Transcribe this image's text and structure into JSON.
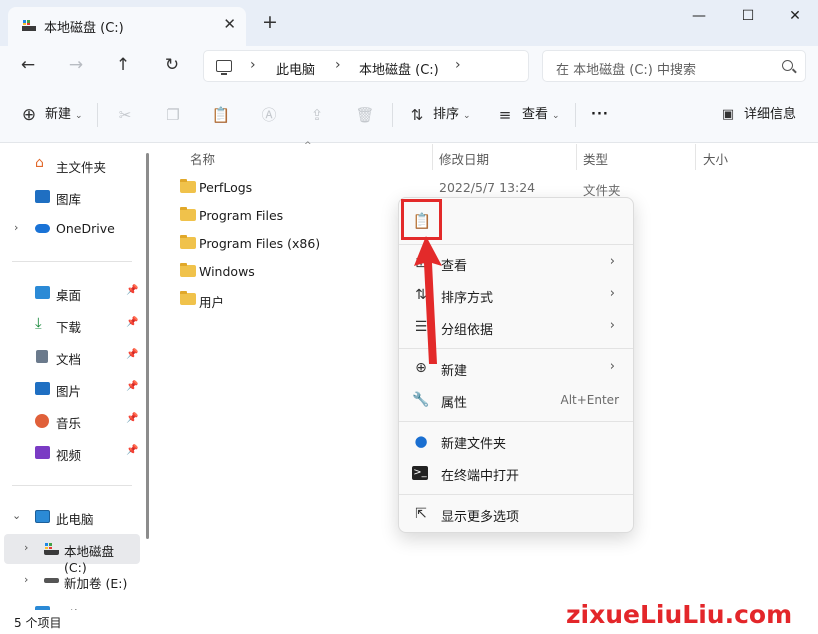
{
  "window": {
    "tab_title": "本地磁盘 (C:)",
    "tab_close": "✕",
    "new_tab": "+",
    "minimize": "—",
    "maximize": "☐",
    "close": "✕"
  },
  "address_bar": {
    "crumbs": [
      "此电脑",
      "本地磁盘 (C:)"
    ],
    "separator": "›",
    "search_placeholder": "在 本地磁盘 (C:) 中搜索"
  },
  "toolbar": {
    "new_label": "新建",
    "sort_label": "排序",
    "view_label": "查看",
    "more_label": "···",
    "details_label": "详细信息"
  },
  "sidebar": {
    "items": [
      {
        "label": "主文件夹",
        "icon": "home-icon"
      },
      {
        "label": "图库",
        "icon": "gallery-icon"
      },
      {
        "label": "OneDrive",
        "icon": "cloud-icon"
      },
      {
        "label": "桌面",
        "icon": "desktop-icon"
      },
      {
        "label": "下载",
        "icon": "download-icon"
      },
      {
        "label": "文档",
        "icon": "document-icon"
      },
      {
        "label": "图片",
        "icon": "picture-icon"
      },
      {
        "label": "音乐",
        "icon": "music-icon"
      },
      {
        "label": "视频",
        "icon": "video-icon"
      },
      {
        "label": "此电脑",
        "icon": "pc-icon"
      },
      {
        "label": "本地磁盘 (C:)",
        "icon": "drive-icon"
      },
      {
        "label": "新加卷 (E:)",
        "icon": "drive-icon"
      },
      {
        "label": "网络",
        "icon": "network-icon"
      }
    ]
  },
  "columns": {
    "name": "名称",
    "modified": "修改日期",
    "type": "类型",
    "size": "大小"
  },
  "files": [
    {
      "name": "PerfLogs",
      "modified": "2022/5/7 13:24",
      "type": "文件夹"
    },
    {
      "name": "Program Files"
    },
    {
      "name": "Program Files (x86)"
    },
    {
      "name": "Windows"
    },
    {
      "name": "用户"
    }
  ],
  "context_menu": {
    "items": [
      {
        "label": "查看",
        "has_submenu": true,
        "icon": "view-icon"
      },
      {
        "label": "排序方式",
        "has_submenu": true,
        "icon": "sort-icon"
      },
      {
        "label": "分组依据",
        "has_submenu": true,
        "icon": "group-icon"
      },
      {
        "label": "新建",
        "has_submenu": true,
        "icon": "new-icon"
      },
      {
        "label": "属性",
        "shortcut": "Alt+Enter",
        "icon": "wrench-icon"
      },
      {
        "label": "新建文件夹",
        "icon": "new-folder-icon"
      },
      {
        "label": "在终端中打开",
        "icon": "terminal-icon"
      },
      {
        "label": "显示更多选项",
        "icon": "more-options-icon"
      }
    ]
  },
  "status": {
    "item_count": "5 个项目"
  },
  "watermark": "zixueLiuLiu.com",
  "colors": {
    "highlight_red": "#e32a2a",
    "accent_blue": "#0067c0",
    "folder_yellow": "#f0c24b"
  }
}
